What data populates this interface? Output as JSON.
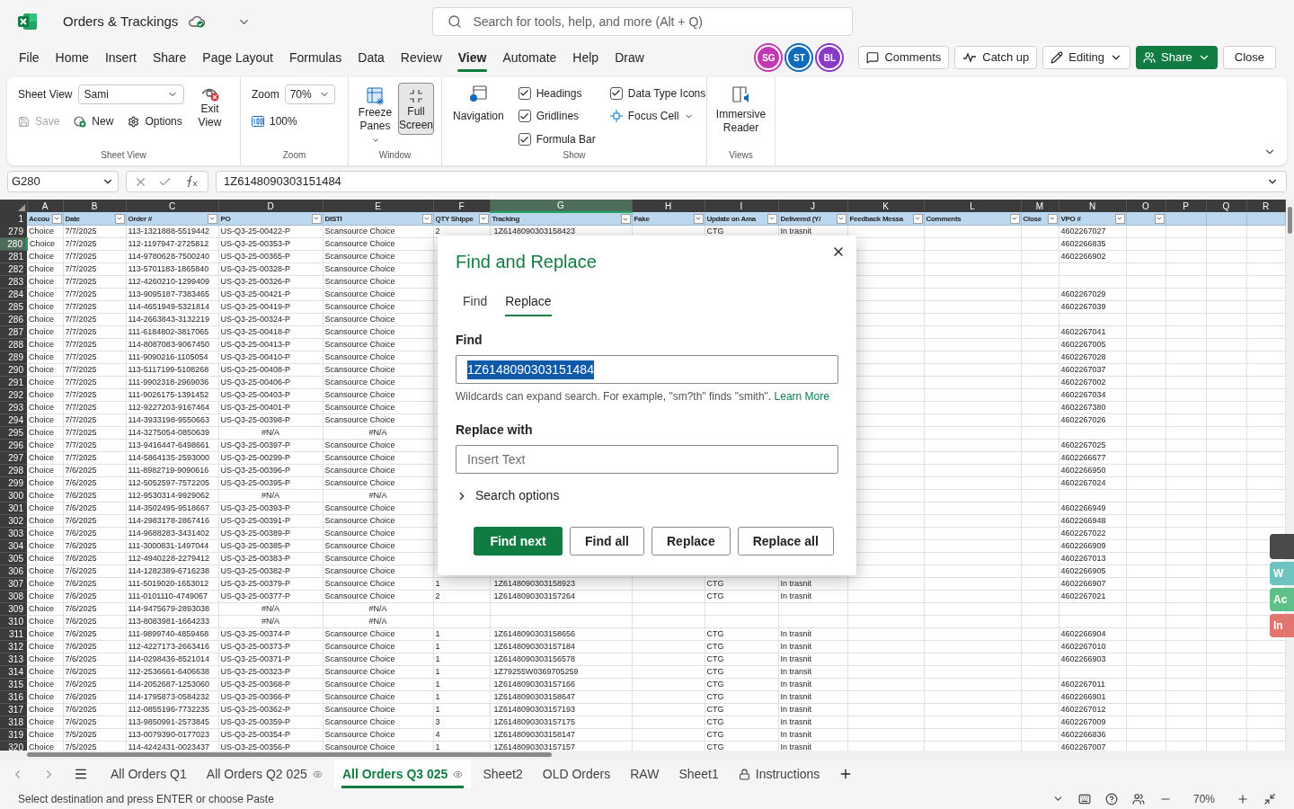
{
  "title_bar": {
    "file_name": "Orders & Trackings",
    "search_placeholder": "Search for tools, help, and more (Alt + Q)"
  },
  "menu": [
    {
      "label": "File",
      "selected": false
    },
    {
      "label": "Home",
      "selected": false
    },
    {
      "label": "Insert",
      "selected": false
    },
    {
      "label": "Share",
      "selected": false
    },
    {
      "label": "Page Layout",
      "selected": false
    },
    {
      "label": "Formulas",
      "selected": false
    },
    {
      "label": "Data",
      "selected": false
    },
    {
      "label": "Review",
      "selected": false
    },
    {
      "label": "View",
      "selected": true
    },
    {
      "label": "Automate",
      "selected": false
    },
    {
      "label": "Help",
      "selected": false
    },
    {
      "label": "Draw",
      "selected": false
    }
  ],
  "avatars": [
    {
      "initials": "SG",
      "color": "#c239b3"
    },
    {
      "initials": "ST",
      "color": "#0f6cbd"
    },
    {
      "initials": "BL",
      "color": "#8a3ac6"
    }
  ],
  "actions": {
    "comments": "Comments",
    "catch_up": "Catch up",
    "editing": "Editing",
    "share": "Share",
    "close": "Close"
  },
  "ribbon": {
    "sheet_view": {
      "label": "Sheet View",
      "view": "Sami",
      "save": {
        "label": "Save",
        "disabled": true
      },
      "new": "New",
      "options": "Options",
      "exit": "Exit View",
      "group": "Sheet View"
    },
    "zoom": {
      "label": "Zoom",
      "value": "70%",
      "reset": "100%",
      "group": "Zoom"
    },
    "window": {
      "freeze": "Freeze Panes",
      "full_screen": {
        "label": "Full Screen",
        "selected": true
      },
      "group": "Window"
    },
    "show": {
      "navigation": "Navigation",
      "checks": [
        {
          "label": "Headings",
          "checked": true
        },
        {
          "label": "Gridlines",
          "checked": true
        },
        {
          "label": "Formula Bar",
          "checked": true
        },
        {
          "label": "Data Type Icons",
          "checked": true
        }
      ],
      "focus_cell": "Focus Cell",
      "group": "Show"
    },
    "views": {
      "immersive": "Immersive Reader",
      "group": "Views"
    }
  },
  "formula_bar": {
    "name_box": "G280",
    "value": "1Z6148090303151484"
  },
  "columns": [
    {
      "letter": "A",
      "title": "Accou",
      "kind": "filtered",
      "selected": false
    },
    {
      "letter": "B",
      "title": "Date",
      "kind": "filtered",
      "selected": false
    },
    {
      "letter": "C",
      "title": "Order #",
      "kind": "filtered",
      "selected": false
    },
    {
      "letter": "D",
      "title": "PO",
      "kind": "filtered",
      "selected": false
    },
    {
      "letter": "E",
      "title": "DISTI",
      "kind": "filtered",
      "selected": false
    },
    {
      "letter": "F",
      "title": "QTY Shippe",
      "kind": "filtered",
      "selected": false
    },
    {
      "letter": "G",
      "title": "Tracking",
      "kind": "filtered",
      "selected": true
    },
    {
      "letter": "H",
      "title": "Fake",
      "kind": "filtered",
      "selected": false
    },
    {
      "letter": "I",
      "title": "Update on Ama",
      "kind": "filtered",
      "selected": false
    },
    {
      "letter": "J",
      "title": "Delivered (Y/",
      "kind": "filtered",
      "selected": false
    },
    {
      "letter": "K",
      "title": "Feedback Messa",
      "kind": "filtered",
      "selected": false
    },
    {
      "letter": "L",
      "title": "Comments",
      "kind": "filtered",
      "selected": false
    },
    {
      "letter": "M",
      "title": "Close",
      "kind": "filtered",
      "selected": false
    },
    {
      "letter": "N",
      "title": "VPO #",
      "kind": "filtered",
      "selected": false
    },
    {
      "letter": "O",
      "kind": "filtered",
      "selected": false
    },
    {
      "letter": "P",
      "kind": "plain",
      "selected": false
    },
    {
      "letter": "Q",
      "kind": "plain",
      "selected": false
    },
    {
      "letter": "R",
      "kind": "plain",
      "selected": false
    }
  ],
  "header_row_number": "1",
  "rows": [
    {
      "number": "279",
      "selected": false,
      "cells": {
        "A": "Choice",
        "B": "7/7/2025",
        "C": "113-1321888-5519442",
        "D": "US-Q3-25-00422-P",
        "E": "Scansource Choice",
        "F": "2",
        "G": "1Z6148090303158423",
        "I": "CTG",
        "J": "In trasnit",
        "N": "4602267027"
      }
    },
    {
      "number": "280",
      "selected": true,
      "cells": {
        "A": "Choice",
        "B": "7/7/2025",
        "C": "112-1197947-2725812",
        "D": "US-Q3-25-00353-P",
        "E": "Scansource Choice",
        "N": "4602266835"
      }
    },
    {
      "number": "281",
      "selected": false,
      "cells": {
        "A": "Choice",
        "B": "7/7/2025",
        "C": "114-9780628-7500240",
        "D": "US-Q3-25-00365-P",
        "E": "Scansource Choice",
        "N": "4602266902"
      }
    },
    {
      "number": "282",
      "selected": false,
      "cells": {
        "A": "Choice",
        "B": "7/7/2025",
        "C": "113-5701183-1865840",
        "D": "US-Q3-25-00328-P",
        "E": "Scansource Choice"
      }
    },
    {
      "number": "283",
      "selected": false,
      "cells": {
        "A": "Choice",
        "B": "7/7/2025",
        "C": "112-4260210-1299409",
        "D": "US-Q3-25-00326-P",
        "E": "Scansource Choice"
      }
    },
    {
      "number": "284",
      "selected": false,
      "cells": {
        "A": "Choice",
        "B": "7/7/2025",
        "C": "113-9095187-7383465",
        "D": "US-Q3-25-00421-P",
        "E": "Scansource Choice",
        "N": "4602267029"
      }
    },
    {
      "number": "285",
      "selected": false,
      "cells": {
        "A": "Choice",
        "B": "7/7/2025",
        "C": "114-4651949-5321814",
        "D": "US-Q3-25-00419-P",
        "E": "Scansource Choice",
        "N": "4602267039"
      }
    },
    {
      "number": "286",
      "selected": false,
      "cells": {
        "A": "Choice",
        "B": "7/7/2025",
        "C": "114-2663843-3132219",
        "D": "US-Q3-25-00324-P",
        "E": "Scansource Choice"
      }
    },
    {
      "number": "287",
      "selected": false,
      "cells": {
        "A": "Choice",
        "B": "7/7/2025",
        "C": "111-6184802-3817065",
        "D": "US-Q3-25-00418-P",
        "E": "Scansource Choice",
        "N": "4602267041"
      }
    },
    {
      "number": "288",
      "selected": false,
      "cells": {
        "A": "Choice",
        "B": "7/7/2025",
        "C": "114-8087083-9067450",
        "D": "US-Q3-25-00413-P",
        "E": "Scansource Choice",
        "N": "4602267005"
      }
    },
    {
      "number": "289",
      "selected": false,
      "cells": {
        "A": "Choice",
        "B": "7/7/2025",
        "C": "111-9090216-1105054",
        "D": "US-Q3-25-00410-P",
        "E": "Scansource Choice",
        "N": "4602267028"
      }
    },
    {
      "number": "290",
      "selected": false,
      "cells": {
        "A": "Choice",
        "B": "7/7/2025",
        "C": "113-5117199-5108268",
        "D": "US-Q3-25-00408-P",
        "E": "Scansource Choice",
        "N": "4602267037"
      }
    },
    {
      "number": "291",
      "selected": false,
      "cells": {
        "A": "Choice",
        "B": "7/7/2025",
        "C": "111-9902318-2969036",
        "D": "US-Q3-25-00406-P",
        "E": "Scansource Choice",
        "N": "4602267002"
      }
    },
    {
      "number": "292",
      "selected": false,
      "cells": {
        "A": "Choice",
        "B": "7/7/2025",
        "C": "111-9026175-1391452",
        "D": "US-Q3-25-00403-P",
        "E": "Scansource Choice",
        "N": "4602267034"
      }
    },
    {
      "number": "293",
      "selected": false,
      "cells": {
        "A": "Choice",
        "B": "7/7/2025",
        "C": "112-9227203-9167464",
        "D": "US-Q3-25-00401-P",
        "E": "Scansource Choice",
        "N": "4602267380"
      }
    },
    {
      "number": "294",
      "selected": false,
      "cells": {
        "A": "Choice",
        "B": "7/7/2025",
        "C": "114-3933198-9550663",
        "D": "US-Q3-25-00398-P",
        "E": "Scansource Choice",
        "N": "4602267026"
      }
    },
    {
      "number": "295",
      "selected": false,
      "cells": {
        "A": "Choice",
        "B": "7/7/2025",
        "C": "114-3275054-0850639",
        "D": {
          "text": "#N/A",
          "kind": "error"
        },
        "E": {
          "text": "#N/A",
          "kind": "error"
        }
      }
    },
    {
      "number": "296",
      "selected": false,
      "cells": {
        "A": "Choice",
        "B": "7/7/2025",
        "C": "113-9416447-6498661",
        "D": "US-Q3-25-00397-P",
        "E": "Scansource Choice",
        "N": "4602267025"
      }
    },
    {
      "number": "297",
      "selected": false,
      "cells": {
        "A": "Choice",
        "B": "7/7/2025",
        "C": "114-5864135-2593000",
        "D": "US-Q3-25-00299-P",
        "E": "Scansource Choice",
        "N": "4602266677"
      }
    },
    {
      "number": "298",
      "selected": false,
      "cells": {
        "A": "Choice",
        "B": "7/6/2025",
        "C": "111-8982719-9090616",
        "D": "US-Q3-25-00396-P",
        "E": "Scansource Choice",
        "N": "4602266950"
      }
    },
    {
      "number": "299",
      "selected": false,
      "cells": {
        "A": "Choice",
        "B": "7/6/2025",
        "C": "112-5052597-7572205",
        "D": "US-Q3-25-00395-P",
        "E": "Scansource Choice",
        "N": "4602267024"
      }
    },
    {
      "number": "300",
      "selected": false,
      "cells": {
        "A": "Choice",
        "B": "7/6/2025",
        "C": "112-9530314-9929062",
        "D": {
          "text": "#N/A",
          "kind": "error"
        },
        "E": {
          "text": "#N/A",
          "kind": "error"
        }
      }
    },
    {
      "number": "301",
      "selected": false,
      "cells": {
        "A": "Choice",
        "B": "7/6/2025",
        "C": "114-3502495-9518667",
        "D": "US-Q3-25-00393-P",
        "E": "Scansource Choice",
        "N": "4602266949"
      }
    },
    {
      "number": "302",
      "selected": false,
      "cells": {
        "A": "Choice",
        "B": "7/6/2025",
        "C": "114-2983178-2867416",
        "D": "US-Q3-25-00391-P",
        "E": "Scansource Choice",
        "N": "4602266948"
      }
    },
    {
      "number": "303",
      "selected": false,
      "cells": {
        "A": "Choice",
        "B": "7/6/2025",
        "C": "114-9688283-3431402",
        "D": "US-Q3-25-00389-P",
        "E": "Scansource Choice",
        "N": "4602267022"
      }
    },
    {
      "number": "304",
      "selected": false,
      "cells": {
        "A": "Choice",
        "B": "7/6/2025",
        "C": "111-3000831-1497044",
        "D": "US-Q3-25-00385-P",
        "E": "Scansource Choice",
        "N": "4602266909"
      }
    },
    {
      "number": "305",
      "selected": false,
      "cells": {
        "A": "Choice",
        "B": "7/6/2025",
        "C": "112-4940228-2279412",
        "D": "US-Q3-25-00383-P",
        "E": "Scansource Choice",
        "N": "4602267013"
      }
    },
    {
      "number": "306",
      "selected": false,
      "cells": {
        "A": "Choice",
        "B": "7/6/2025",
        "C": "114-1282389-6716238",
        "D": "US-Q3-25-00382-P",
        "E": "Scansource Choice",
        "N": "4602266905"
      }
    },
    {
      "number": "307",
      "selected": false,
      "cells": {
        "A": "Choice",
        "B": "7/6/2025",
        "C": "111-5019020-1653012",
        "D": "US-Q3-25-00379-P",
        "E": "Scansource Choice",
        "F": "1",
        "G": "1Z6148090303158923",
        "I": "CTG",
        "J": "In trasnit",
        "N": "4602266907"
      }
    },
    {
      "number": "308",
      "selected": false,
      "cells": {
        "A": "Choice",
        "B": "7/6/2025",
        "C": "111-0101110-4749067",
        "D": "US-Q3-25-00377-P",
        "E": "Scansource Choice",
        "F": "2",
        "G": "1Z6148090303157264",
        "I": "CTG",
        "J": "In trasnit",
        "N": "4602267021"
      }
    },
    {
      "number": "309",
      "selected": false,
      "cells": {
        "A": "Choice",
        "B": "7/6/2025",
        "C": "114-9475679-2893038",
        "D": {
          "text": "#N/A",
          "kind": "error"
        },
        "E": {
          "text": "#N/A",
          "kind": "error"
        }
      }
    },
    {
      "number": "310",
      "selected": false,
      "cells": {
        "A": "Choice",
        "B": "7/6/2025",
        "C": "113-8083981-1664233",
        "D": {
          "text": "#N/A",
          "kind": "error"
        },
        "E": {
          "text": "#N/A",
          "kind": "error"
        }
      }
    },
    {
      "number": "311",
      "selected": false,
      "cells": {
        "A": "Choice",
        "B": "7/6/2025",
        "C": "111-9899740-4859468",
        "D": "US-Q3-25-00374-P",
        "E": "Scansource Choice",
        "F": "1",
        "G": "1Z6148090303158656",
        "I": "CTG",
        "J": "In trasnit",
        "N": "4602266904"
      }
    },
    {
      "number": "312",
      "selected": false,
      "cells": {
        "A": "Choice",
        "B": "7/6/2025",
        "C": "112-4227173-2663416",
        "D": "US-Q3-25-00373-P",
        "E": "Scansource Choice",
        "F": "1",
        "G": "1Z6148090303157184",
        "I": "CTG",
        "J": "In trasnit",
        "N": "4602267010"
      }
    },
    {
      "number": "313",
      "selected": false,
      "cells": {
        "A": "Choice",
        "B": "7/6/2025",
        "C": "114-0298436-8521014",
        "D": "US-Q3-25-00371-P",
        "E": "Scansource Choice",
        "F": "1",
        "G": "1Z6148090303156578",
        "I": "CTG",
        "J": "In trasnit",
        "N": "4602266903"
      }
    },
    {
      "number": "314",
      "selected": false,
      "cells": {
        "A": "Choice",
        "B": "7/6/2025",
        "C": "112-2536661-6406638",
        "D": "US-Q3-25-00323-P",
        "E": "Scansource Choice",
        "F": "1",
        "G": "1Z79255W0369705259",
        "I": "CTG",
        "J": "In transit"
      }
    },
    {
      "number": "315",
      "selected": false,
      "cells": {
        "A": "Choice",
        "B": "7/6/2025",
        "C": "114-2052687-1253060",
        "D": "US-Q3-25-00368-P",
        "E": "Scansource Choice",
        "F": "1",
        "G": "1Z6148090303157166",
        "I": "CTG",
        "J": "In trasnit",
        "N": "4602267011"
      }
    },
    {
      "number": "316",
      "selected": false,
      "cells": {
        "A": "Choice",
        "B": "7/6/2025",
        "C": "114-1795873-0584232",
        "D": "US-Q3-25-00366-P",
        "E": "Scansource Choice",
        "F": "1",
        "G": "1Z6148090303158647",
        "I": "CTG",
        "J": "In trasnit",
        "N": "4602266901"
      }
    },
    {
      "number": "317",
      "selected": false,
      "cells": {
        "A": "Choice",
        "B": "7/6/2025",
        "C": "112-0855196-7732235",
        "D": "US-Q3-25-00362-P",
        "E": "Scansource Choice",
        "F": "1",
        "G": "1Z6148090303157193",
        "I": "CTG",
        "J": "In trasnit",
        "N": "4602267012"
      }
    },
    {
      "number": "318",
      "selected": false,
      "cells": {
        "A": "Choice",
        "B": "7/6/2025",
        "C": "113-9850991-2573845",
        "D": "US-Q3-25-00359-P",
        "E": "Scansource Choice",
        "F": "3",
        "G": "1Z6148090303157175",
        "I": "CTG",
        "J": "In trasnit",
        "N": "4602267009"
      }
    },
    {
      "number": "319",
      "selected": false,
      "cells": {
        "A": "Choice",
        "B": "7/5/2025",
        "C": "113-0079390-0177023",
        "D": "US-Q3-25-00354-P",
        "E": "Scansource Choice",
        "F": "4",
        "G": "1Z6148090303158147",
        "I": "CTG",
        "J": "In trasnit",
        "N": "4602266836"
      }
    },
    {
      "number": "320",
      "selected": false,
      "cells": {
        "A": "Choice",
        "B": "7/5/2025",
        "C": "114-4242431-0023437",
        "D": "US-Q3-25-00356-P",
        "E": "Scansource Choice",
        "F": "1",
        "G": "1Z6148090303157157",
        "I": "CTG",
        "J": "In trasnit",
        "N": "4602267007"
      }
    }
  ],
  "dialog": {
    "title": "Find and Replace",
    "tabs": [
      {
        "label": "Find",
        "selected": false
      },
      {
        "label": "Replace",
        "selected": true
      }
    ],
    "find_label": "Find",
    "find_value": "1Z6148090303151484",
    "find_value_selected": true,
    "hint": "Wildcards can expand search. For example, \"sm?th\" finds \"smith\".",
    "hint_link": "Learn More",
    "replace_label": "Replace with",
    "replace_placeholder": "Insert Text",
    "search_options": {
      "label": "Search options",
      "expanded": false
    },
    "buttons": [
      {
        "label": "Find next",
        "kind": "primary"
      },
      {
        "label": "Find all",
        "kind": "secondary"
      },
      {
        "label": "Replace",
        "kind": "secondary"
      },
      {
        "label": "Replace all",
        "kind": "secondary"
      }
    ]
  },
  "side_tabs": [
    {
      "label": "W",
      "color": "#6cc3c0"
    },
    {
      "label": "Ac",
      "color": "#5fc08a"
    },
    {
      "label": "In",
      "color": "#e2756f"
    }
  ],
  "sheet_tabs": [
    {
      "label": "All Orders Q1",
      "selected": false,
      "kind": "plain"
    },
    {
      "label": "All Orders Q2 025",
      "selected": false,
      "kind": "viewed"
    },
    {
      "label": "All Orders Q3 025",
      "selected": true,
      "kind": "viewed"
    },
    {
      "label": "Sheet2",
      "selected": false,
      "kind": "plain"
    },
    {
      "label": "OLD Orders",
      "selected": false,
      "kind": "plain"
    },
    {
      "label": "RAW",
      "selected": false,
      "kind": "plain"
    },
    {
      "label": "Sheet1",
      "selected": false,
      "kind": "plain"
    },
    {
      "label": "Instructions",
      "selected": false,
      "kind": "locked"
    }
  ],
  "status_bar": {
    "message": "Select destination and press ENTER or choose Paste",
    "zoom": "70%"
  }
}
